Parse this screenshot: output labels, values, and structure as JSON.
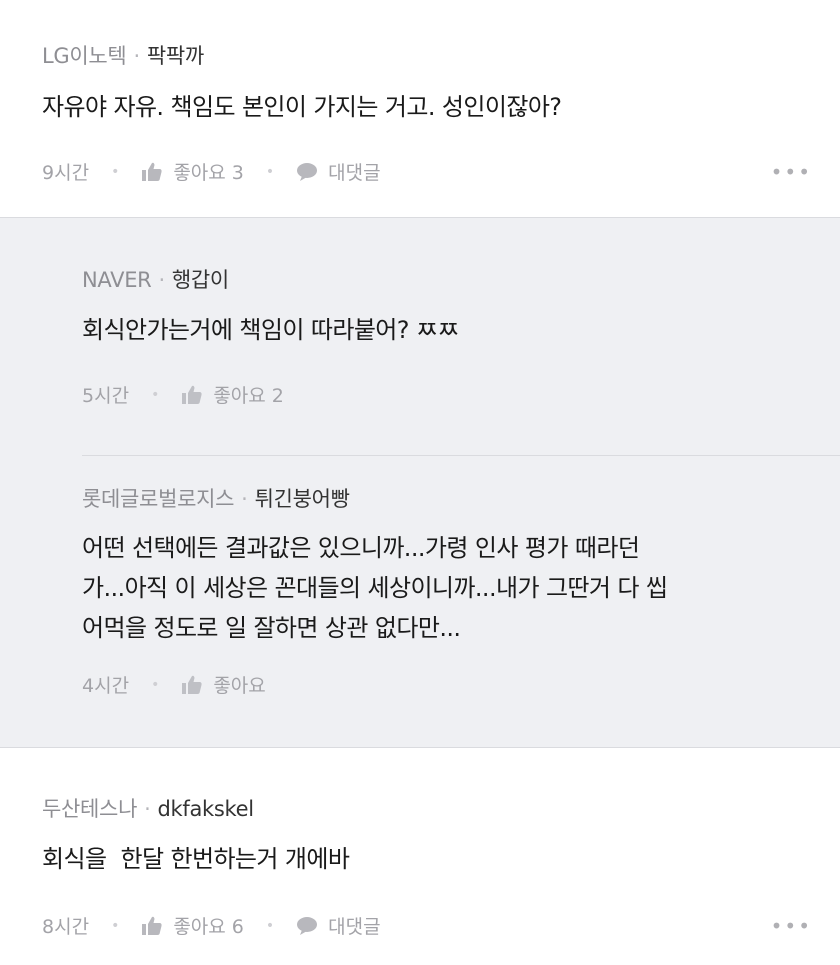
{
  "comments": [
    {
      "company": "LG이노텍",
      "nick": "팍팍까",
      "text_lines": [
        "자유야 자유. 책임도 본인이 가지는 거고. 성인이잖아?"
      ],
      "time": "9시간",
      "like_label": "좋아요 3",
      "reply_label": "대댓글",
      "more": "•••"
    },
    {
      "company": "NAVER",
      "nick": "행갑이",
      "text_lines": [
        "회식안가는거에 책임이 따라붙어? ㅉㅉ"
      ],
      "time": "5시간",
      "like_label": "좋아요 2"
    },
    {
      "company": "롯데글로벌로지스",
      "nick": "튀긴붕어빵",
      "text_lines": [
        "어떤 선택에든 결과값은 있으니까...가령 인사 평가 때라던",
        "가...아직 이 세상은 꼰대들의 세상이니까...내가 그딴거 다 씹",
        "어먹을 정도로 일 잘하면 상관 없다만..."
      ],
      "time": "4시간",
      "like_label": "좋아요"
    },
    {
      "company": "두산테스나",
      "nick": "dkfakskel",
      "text_lines": [
        "회식을  한달 한번하는거 개에바"
      ],
      "time": "8시간",
      "like_label": "좋아요 6",
      "reply_label": "대댓글",
      "more": "•••"
    }
  ],
  "separator": "·",
  "icons": {
    "like": "thumbs-up-icon",
    "reply": "speech-bubble-icon",
    "more": "more-dots-icon"
  },
  "colors": {
    "reply_background": "#eff0f3",
    "divider": "#dadbdf",
    "meta_gray": "#8e8e93",
    "action_gray": "#a3a3a8"
  }
}
